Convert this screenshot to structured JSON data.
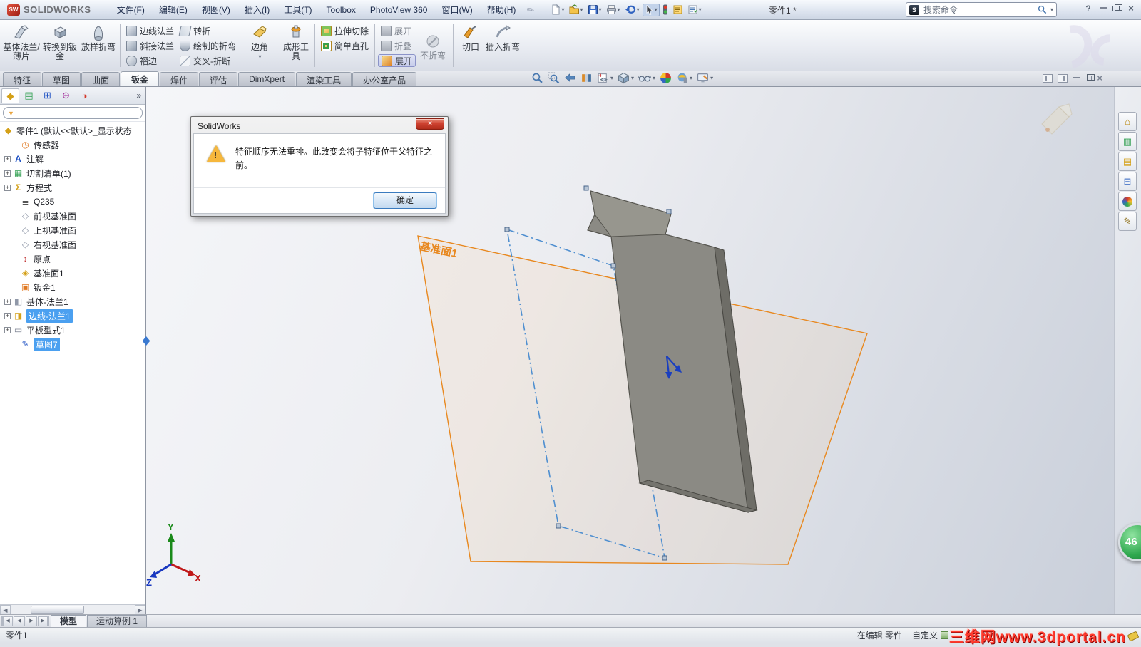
{
  "icons": {
    "dropdown": "▾",
    "chevron_right": "»",
    "plus": "+",
    "funnel": "▼",
    "help": "?",
    "close": "×",
    "left": "◀",
    "right": "▶",
    "search_logo": "S",
    "pin": "✎"
  },
  "titlebar": {
    "app_name": "SOLIDWORKS",
    "logo_mark": "SW",
    "menus": [
      "文件(F)",
      "编辑(E)",
      "视图(V)",
      "插入(I)",
      "工具(T)",
      "Toolbox",
      "PhotoView 360",
      "窗口(W)",
      "帮助(H)"
    ],
    "doc_title": "零件1 *",
    "search_placeholder": "搜索命令"
  },
  "ribbon": {
    "large": [
      "基体法兰/薄片",
      "转换到钣金",
      "放样折弯"
    ],
    "col1": [
      "边线法兰",
      "斜接法兰",
      "褶边"
    ],
    "col2": [
      "转折",
      "绘制的折弯",
      "交叉-折断"
    ],
    "corner": "边角",
    "forming": "成形工具",
    "col3": [
      "拉伸切除",
      "简单直孔"
    ],
    "col4": [
      "展开",
      "折叠",
      "展开"
    ],
    "no_bend": "不折弯",
    "rip": "切口",
    "insert_bends": "插入折弯"
  },
  "command_tabs": [
    "特征",
    "草图",
    "曲面",
    "钣金",
    "焊件",
    "评估",
    "DimXpert",
    "渲染工具",
    "办公室产品"
  ],
  "feature_tree": {
    "root": "零件1 (默认<<默认>_显示状态",
    "items": [
      {
        "label": "传感器",
        "glyph": "◷",
        "expand": false,
        "selected": false
      },
      {
        "label": "注解",
        "glyph": "A",
        "expand": true,
        "selected": false
      },
      {
        "label": "切割清单(1)",
        "glyph": "▦",
        "expand": true,
        "selected": false
      },
      {
        "label": "方程式",
        "glyph": "Σ",
        "expand": true,
        "selected": false
      },
      {
        "label": "Q235",
        "glyph": "≣",
        "expand": false,
        "selected": false
      },
      {
        "label": "前视基准面",
        "glyph": "◇",
        "expand": false,
        "selected": false
      },
      {
        "label": "上视基准面",
        "glyph": "◇",
        "expand": false,
        "selected": false
      },
      {
        "label": "右视基准面",
        "glyph": "◇",
        "expand": false,
        "selected": false
      },
      {
        "label": "原点",
        "glyph": "↕",
        "expand": false,
        "selected": false
      },
      {
        "label": "基准面1",
        "glyph": "◈",
        "expand": false,
        "selected": false
      },
      {
        "label": "钣金1",
        "glyph": "▣",
        "expand": false,
        "selected": false
      },
      {
        "label": "基体-法兰1",
        "glyph": "◧",
        "expand": true,
        "selected": false
      },
      {
        "label": "边线-法兰1",
        "glyph": "◨",
        "expand": true,
        "selected": true
      },
      {
        "label": "平板型式1",
        "glyph": "▭",
        "expand": true,
        "selected": false
      },
      {
        "label": "草图7",
        "glyph": "✎",
        "expand": false,
        "selected": true
      }
    ]
  },
  "dialog": {
    "title": "SolidWorks",
    "message": "特征顺序无法重排。此改变会将子特征位于父特征之前。",
    "ok_label": "确定"
  },
  "viewport": {
    "plane_label": "基准面1",
    "triad": {
      "x": "X",
      "y": "Y",
      "z": "Z"
    },
    "badge": "46"
  },
  "bottom": {
    "doc_tabs": [
      "模型",
      "运动算例 1"
    ],
    "status_left": "零件1",
    "status_editing": "在编辑 零件",
    "status_customize": "自定义",
    "watermark": "三维网www.3dportal.cn"
  },
  "colors": {
    "selection_blue": "#4ba0f0",
    "plane_orange": "#e8881f",
    "sketch_blue": "#4f8fd0",
    "dialog_close_red": "#cf4231",
    "watermark_red": "#ff3b2e",
    "badge_green": "#2fa84e"
  }
}
